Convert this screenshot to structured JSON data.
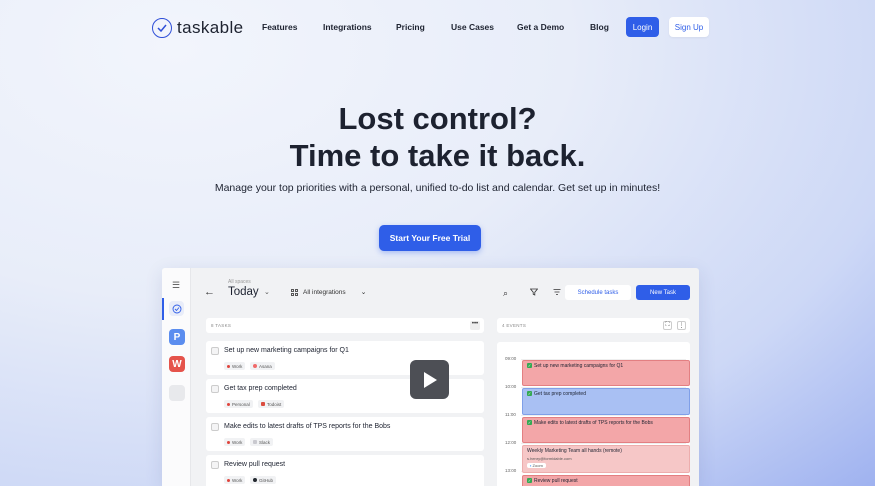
{
  "nav": {
    "logo_text": "taskable",
    "links": [
      "Features",
      "Integrations",
      "Pricing",
      "Use Cases",
      "Get a Demo",
      "Blog"
    ],
    "login_label": "Login",
    "signup_label": "Sign Up"
  },
  "hero": {
    "title_line1": "Lost control?",
    "title_line2": "Time to take it back.",
    "subtitle": "Manage your top priorities with a personal, unified to-do list and calendar. Get set up in minutes!",
    "cta_label": "Start Your Free Trial"
  },
  "app": {
    "rail": {
      "menu_icon": "☰",
      "space_p": "P",
      "space_w": "W",
      "colors": {
        "p": "#5b8def",
        "w": "#e5534b"
      }
    },
    "topbar": {
      "space_label": "All spaces",
      "view_label": "Today",
      "integrations_label": "All integrations",
      "schedule_label": "Schedule tasks",
      "new_task_label": "New Task"
    },
    "tasks": {
      "count_label": "8 TASKS",
      "items": [
        {
          "title": "Set up new marketing campaigns for Q1",
          "space": "Work",
          "source": "Asana"
        },
        {
          "title": "Get tax prep completed",
          "space": "Personal",
          "source": "Todoist"
        },
        {
          "title": "Make edits to latest drafts of TPS reports for the Bobs",
          "space": "Work",
          "source": "Slack"
        },
        {
          "title": "Review pull request",
          "space": "Work",
          "source": "GitHub"
        }
      ]
    },
    "events": {
      "count_label": "4 EVENTS",
      "hours": [
        "09:00",
        "10:00",
        "11:00",
        "12:00",
        "13:00"
      ],
      "items": [
        {
          "title": "Set up new marketing campaigns for Q1",
          "done": true
        },
        {
          "title": "Get tax prep completed",
          "done": true
        },
        {
          "title": "Make edits to latest drafts of TPS reports for the Bobs",
          "done": true
        },
        {
          "title": "Weekly Marketing Team all hands (remote)",
          "meta": "s.henry@formidable.com",
          "tag": "Zoom",
          "done": false
        },
        {
          "title": "Review pull request",
          "done": true
        }
      ]
    }
  },
  "colors": {
    "accent": "#2f5ee8",
    "event_red": "#f3a6a8",
    "event_blue": "#a9c0f3"
  }
}
